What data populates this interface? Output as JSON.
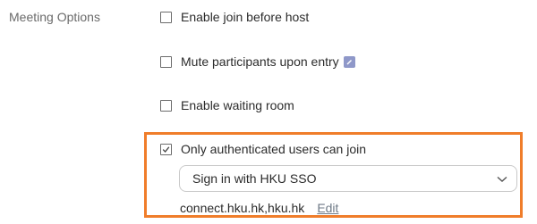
{
  "section": {
    "label": "Meeting Options"
  },
  "options": [
    {
      "label": "Enable join before host",
      "checked": false
    },
    {
      "label": "Mute participants upon entry",
      "checked": false,
      "icon": "info-icon"
    },
    {
      "label": "Enable waiting room",
      "checked": false
    },
    {
      "label": "Only authenticated users can join",
      "checked": true
    }
  ],
  "auth": {
    "selected_option": "Sign in with HKU SSO",
    "domains": "connect.hku.hk,hku.hk",
    "edit_label": "Edit"
  },
  "colors": {
    "highlight": "#f07d2a",
    "info_icon": "#8f98c9"
  }
}
